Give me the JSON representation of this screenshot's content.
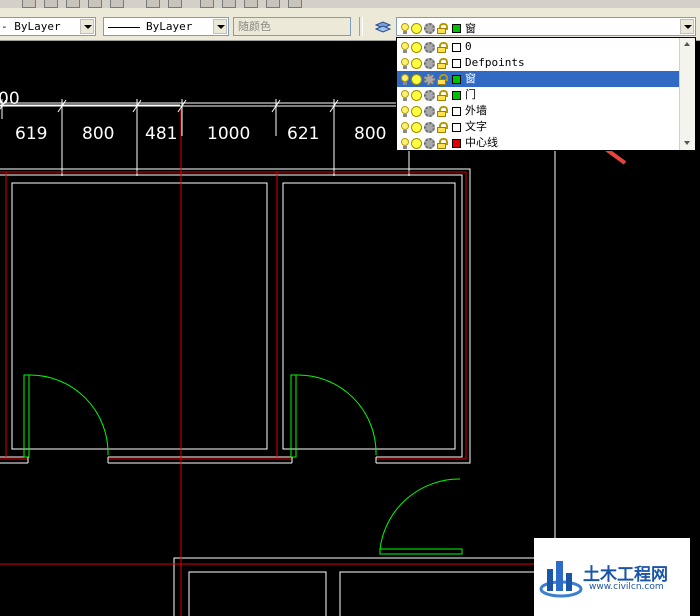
{
  "toolbar": {
    "linetype_value": "ByLayer",
    "lineweight_value": "ByLayer",
    "plotstyle_value": "随颜色"
  },
  "layers": {
    "current": {
      "name": "窗",
      "color": "#00c000"
    },
    "items": [
      {
        "name": "0",
        "color": "#ffffff",
        "selected": false
      },
      {
        "name": "Defpoints",
        "color": "#ffffff",
        "selected": false
      },
      {
        "name": "窗",
        "color": "#00c000",
        "selected": true
      },
      {
        "name": "门",
        "color": "#00c000",
        "selected": false
      },
      {
        "name": "外墙",
        "color": "#ffffff",
        "selected": false
      },
      {
        "name": "文字",
        "color": "#ffffff",
        "selected": false
      },
      {
        "name": "中心线",
        "color": "#e00000",
        "selected": false
      }
    ]
  },
  "drawing": {
    "dimensions": [
      "00",
      "619",
      "800",
      "481",
      "1000",
      "621",
      "800"
    ],
    "colors": {
      "wall": "#ffffff",
      "door": "#00ff00",
      "axis": "#e00000",
      "dim": "#ffffff",
      "annotation_arrow": "#e8433c"
    }
  },
  "watermark": {
    "title": "土木工程网",
    "url": "www.civilcn.com"
  }
}
